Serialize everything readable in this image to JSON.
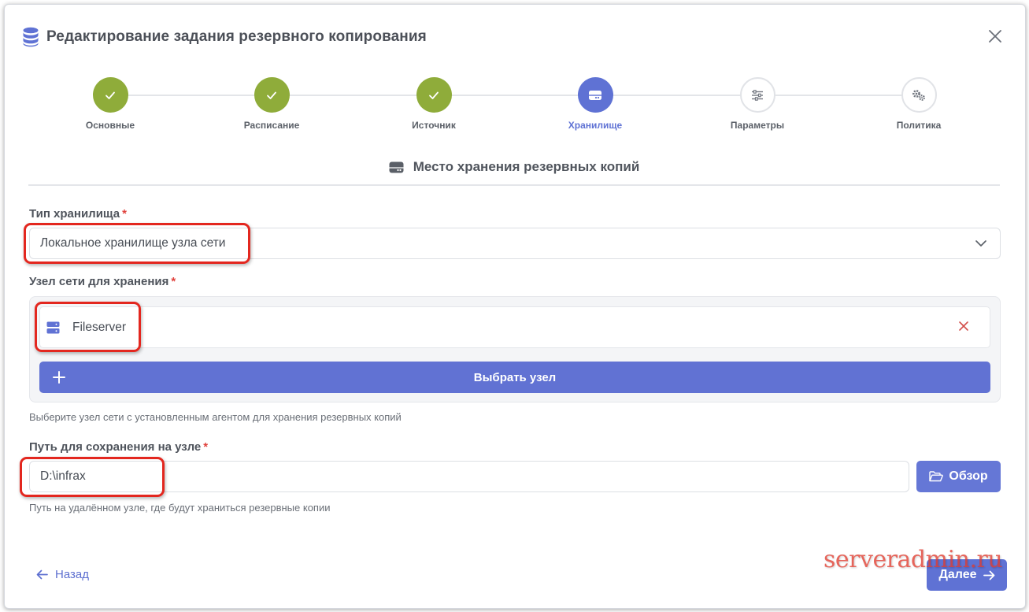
{
  "dialog": {
    "title": "Редактирование задания резервного копирования",
    "icon": "database-icon"
  },
  "steps": [
    {
      "label": "Основные",
      "state": "done"
    },
    {
      "label": "Расписание",
      "state": "done"
    },
    {
      "label": "Источник",
      "state": "done"
    },
    {
      "label": "Хранилище",
      "state": "active"
    },
    {
      "label": "Параметры",
      "state": "pending"
    },
    {
      "label": "Политика",
      "state": "pending"
    }
  ],
  "section": {
    "title": "Место хранения резервных копий",
    "icon": "hard-drive-icon"
  },
  "storage_type": {
    "label": "Тип хранилища",
    "required_mark": "*",
    "value": "Локальное хранилище узла сети"
  },
  "storage_node": {
    "label": "Узел сети для хранения",
    "required_mark": "*",
    "selected_node": "Fileserver",
    "choose_button": "Выбрать узел",
    "help": "Выберите узел сети с установленным агентом для хранения резервных копий"
  },
  "storage_path": {
    "label": "Путь для сохранения на узле",
    "required_mark": "*",
    "value": "D:\\infrax",
    "browse_button": "Обзор",
    "help": "Путь на удалённом узле, где будут храниться резервные копии"
  },
  "footer": {
    "back": "Назад",
    "next": "Далее"
  },
  "watermark": "serveradmin.ru",
  "colors": {
    "accent": "#5f72d4",
    "done": "#8fac3a",
    "required": "#e0413c",
    "annotation": "#e3271f"
  }
}
